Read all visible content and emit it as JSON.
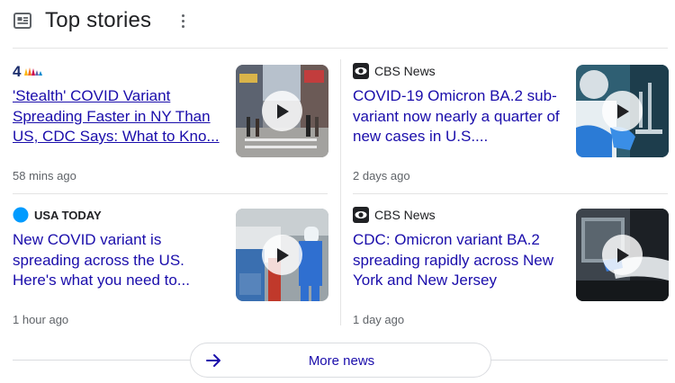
{
  "header": {
    "title": "Top stories",
    "title_icon": "newspaper-icon",
    "menu_icon": "more-vert-icon"
  },
  "stories": [
    {
      "source": "",
      "source_logo": "nbc-peacock-logo",
      "headline": "'Stealth' COVID Variant Spreading Faster in NY Than US, CDC Says: What to Kno...",
      "time": "58 mins ago",
      "thumbnail": "times-square-street-scene",
      "has_video": true,
      "visited": true
    },
    {
      "source": "CBS News",
      "source_logo": "cbs-eye-logo",
      "headline": "COVID-19 Omicron BA.2 sub-variant now nearly a quarter of new cases in U.S....",
      "time": "2 days ago",
      "thumbnail": "lab-researcher-scene",
      "has_video": true,
      "visited": false
    },
    {
      "source": "USA TODAY",
      "source_logo": "usa-today-dot-logo",
      "headline": "New COVID variant is spreading across the US. Here's what you need to...",
      "time": "1 hour ago",
      "thumbnail": "testing-site-scene",
      "has_video": true,
      "visited": false
    },
    {
      "source": "CBS News",
      "source_logo": "cbs-eye-logo",
      "headline": "CDC: Omicron variant BA.2 spreading rapidly across New York and New Jersey",
      "time": "1 day ago",
      "thumbnail": "drive-through-testing-scene",
      "has_video": true,
      "visited": false
    }
  ],
  "more": {
    "label": "More news",
    "icon": "arrow-right-icon"
  },
  "colors": {
    "link": "#1a0dab",
    "meta": "#5f6368",
    "divider": "#e4e4e4",
    "usa_today_blue": "#009bff"
  }
}
